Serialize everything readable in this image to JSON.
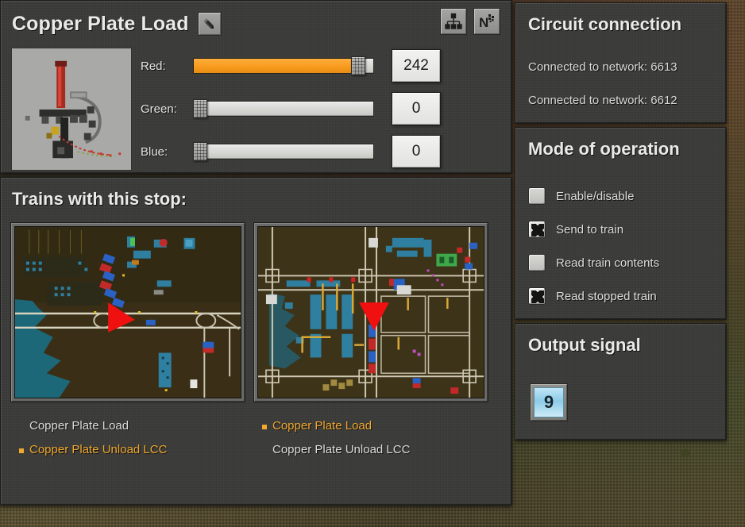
{
  "entity": {
    "title": "Copper Plate Load",
    "edit_icon": "pencil-icon",
    "header_buttons": [
      {
        "name": "circuit-network-tree-icon",
        "label": ""
      },
      {
        "name": "signal-letter-n-icon",
        "label": ""
      }
    ],
    "preview_icon": "train-stop-entity-preview"
  },
  "color_sliders": {
    "rows": [
      {
        "label": "Red:",
        "value": "242",
        "percent": 94.9
      },
      {
        "label": "Green:",
        "value": "0",
        "percent": 0
      },
      {
        "label": "Blue:",
        "value": "0",
        "percent": 0
      }
    ]
  },
  "trains": {
    "heading": "Trains with this stop:",
    "items": [
      {
        "minimap_name": "train-minimap-1",
        "schedule": [
          {
            "text": "Copper Plate Load",
            "active": false
          },
          {
            "text": "Copper Plate Unload LCC",
            "active": true
          }
        ]
      },
      {
        "minimap_name": "train-minimap-2",
        "schedule": [
          {
            "text": "Copper Plate Load",
            "active": true
          },
          {
            "text": "Copper Plate Unload LCC",
            "active": false
          }
        ]
      }
    ]
  },
  "circuit": {
    "heading": "Circuit connection",
    "networks": [
      "Connected to network: 6613",
      "Connected to network: 6612"
    ]
  },
  "mode": {
    "heading": "Mode of operation",
    "options": [
      {
        "label": "Enable/disable",
        "checked": false
      },
      {
        "label": "Send to train",
        "checked": true
      },
      {
        "label": "Read train contents",
        "checked": false
      },
      {
        "label": "Read stopped train",
        "checked": true
      }
    ]
  },
  "output": {
    "heading": "Output signal",
    "signal_value": "9"
  },
  "colors": {
    "accent_orange": "#f0a830",
    "panel_bg": "#3b3b39",
    "text_light": "#eaeaea",
    "signal_blue": "#8ecbe8"
  }
}
